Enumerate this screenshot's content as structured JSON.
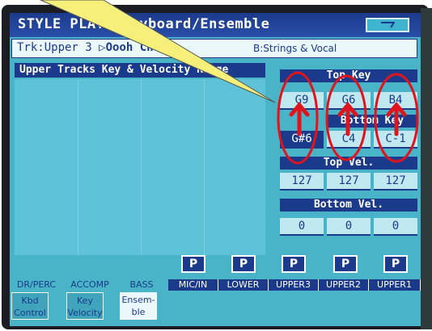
{
  "window": {
    "title": "STYLE PLAY: Keyboard/Ensemble",
    "menu_icon": "menu-icon"
  },
  "track": {
    "label": "Trk:Upper 3",
    "play_icon": "play-triangle-icon",
    "sound_name": "Oooh Choir",
    "bank": "B:Strings & Vocal"
  },
  "section": {
    "title": "Upper Tracks Key & Velocity Range"
  },
  "ranges": {
    "top_key_label": "Top Key",
    "bottom_key_label": "Bottom Key",
    "top_vel_label": "Top Vel.",
    "bottom_vel_label": "Bottom Vel.",
    "top_key": [
      "G9",
      "G6",
      "B4"
    ],
    "bottom_key": [
      "G#6",
      "C4",
      "C-1"
    ],
    "top_vel": [
      "127",
      "127",
      "127"
    ],
    "bottom_vel": [
      "0",
      "0",
      "0"
    ]
  },
  "p_buttons": [
    "P",
    "P",
    "P",
    "P",
    "P"
  ],
  "channels": [
    {
      "label": "DR/PERC",
      "active": false
    },
    {
      "label": "ACCOMP",
      "active": false
    },
    {
      "label": "BASS",
      "active": false
    },
    {
      "label": "MIC/IN",
      "active": true
    },
    {
      "label": "LOWER",
      "active": true
    },
    {
      "label": "UPPER3",
      "active": true
    },
    {
      "label": "UPPER2",
      "active": true
    },
    {
      "label": "UPPER1",
      "active": true
    }
  ],
  "tabs": [
    {
      "line1": "Kbd",
      "line2": "Control",
      "active": false
    },
    {
      "line1": "Key",
      "line2": "Velocity",
      "active": false
    },
    {
      "line1": "Ensem-",
      "line2": "ble",
      "active": true
    }
  ],
  "colors": {
    "screen_bg": "#49b4c8",
    "header_blue": "#1c3a8c",
    "annotation_red": "#e0141c",
    "callout_yellow": "#f6f07a"
  }
}
